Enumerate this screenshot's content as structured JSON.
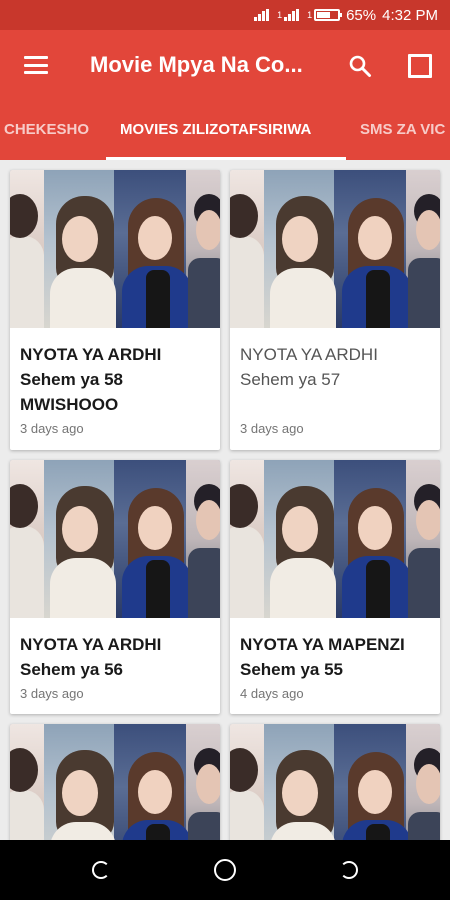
{
  "status_bar": {
    "network_1": "1",
    "network_2": "1",
    "battery": "65%",
    "battery_level": 0.65,
    "time": "4:32 PM"
  },
  "app_bar": {
    "title": "Movie Mpya Na Co...",
    "icons": [
      "menu-icon",
      "search-icon",
      "square-icon"
    ]
  },
  "tabs": [
    {
      "label": "CHEKESHO",
      "active": false
    },
    {
      "label": "MOVIES ZILIZOTAFSIRIWA",
      "active": true
    },
    {
      "label": "SMS ZA VIC",
      "active": false
    }
  ],
  "cards": [
    {
      "title": "NYOTA YA ARDHI Sehem ya 58 MWISHOOO",
      "date": "3 days ago"
    },
    {
      "title": "NYOTA YA ARDHI Sehem ya 57",
      "date": "3 days ago"
    },
    {
      "title": "NYOTA YA ARDHI Sehem ya 56",
      "date": "3 days ago"
    },
    {
      "title": "NYOTA YA MAPENZI Sehem ya 55",
      "date": "4 days ago"
    },
    {
      "title": "",
      "date": ""
    },
    {
      "title": "",
      "date": ""
    }
  ],
  "nav_bar": {
    "icons": [
      "back-icon",
      "home-icon",
      "recent-apps-icon"
    ]
  },
  "colors": {
    "app_bar": "#e2463a",
    "status_bar": "#c8372c",
    "background": "#ececec",
    "nav_bar": "#000000"
  }
}
